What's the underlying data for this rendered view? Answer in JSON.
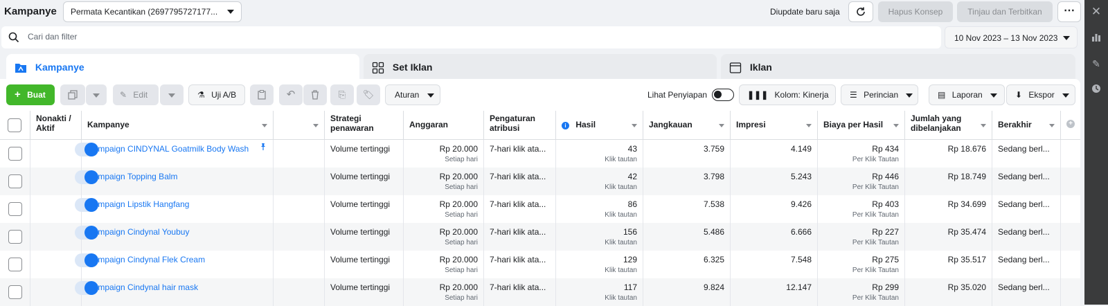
{
  "header": {
    "title": "Kampanye",
    "account": "Permata Kecantikan (2697795727177...",
    "updated": "Diupdate baru saja",
    "discard_label": "Hapus Konsep",
    "publish_label": "Tinjau dan Terbitkan"
  },
  "search": {
    "placeholder": "Cari dan filter",
    "date_range": "10 Nov 2023 – 13 Nov 2023"
  },
  "tabs": [
    {
      "label": "Kampanye",
      "active": true
    },
    {
      "label": "Set Iklan",
      "active": false
    },
    {
      "label": "Iklan",
      "active": false
    }
  ],
  "toolbar": {
    "create": "Buat",
    "edit": "Edit",
    "ab_test": "Uji A/B",
    "rules": "Aturan",
    "preview": "Lihat Penyiapan",
    "columns": "Kolom: Kinerja",
    "breakdown": "Perincian",
    "reports": "Laporan",
    "export": "Ekspor"
  },
  "table": {
    "columns": {
      "toggle": "Nonakti / Aktif",
      "campaign": "Kampanye",
      "bid": "Strategi penawaran",
      "budget": "Anggaran",
      "attribution": "Pengaturan atribusi",
      "results": "Hasil",
      "reach": "Jangkauan",
      "impressions": "Impresi",
      "cost": "Biaya per Hasil",
      "spent": "Jumlah yang dibelanjakan",
      "ends": "Berakhir"
    },
    "rows": [
      {
        "name": "Campaign CINDYNAL Goatmilk Body Wash",
        "bid": "Volume tertinggi",
        "budget": "Rp 20.000",
        "budget_sub": "Setiap hari",
        "attribution": "7-hari klik ata...",
        "results": "43",
        "results_sub": "Klik tautan",
        "reach": "3.759",
        "impressions": "4.149",
        "cost": "Rp 434",
        "cost_sub": "Per Klik Tautan",
        "spent": "Rp 18.676",
        "ends": "Sedang berl..."
      },
      {
        "name": "Campaign Topping Balm",
        "bid": "Volume tertinggi",
        "budget": "Rp 20.000",
        "budget_sub": "Setiap hari",
        "attribution": "7-hari klik ata...",
        "results": "42",
        "results_sub": "Klik tautan",
        "reach": "3.798",
        "impressions": "5.243",
        "cost": "Rp 446",
        "cost_sub": "Per Klik Tautan",
        "spent": "Rp 18.749",
        "ends": "Sedang berl..."
      },
      {
        "name": "Campaign Lipstik Hangfang",
        "bid": "Volume tertinggi",
        "budget": "Rp 20.000",
        "budget_sub": "Setiap hari",
        "attribution": "7-hari klik ata...",
        "results": "86",
        "results_sub": "Klik tautan",
        "reach": "7.538",
        "impressions": "9.426",
        "cost": "Rp 403",
        "cost_sub": "Per Klik Tautan",
        "spent": "Rp 34.699",
        "ends": "Sedang berl..."
      },
      {
        "name": "Campaign Cindynal Youbuy",
        "bid": "Volume tertinggi",
        "budget": "Rp 20.000",
        "budget_sub": "Setiap hari",
        "attribution": "7-hari klik ata...",
        "results": "156",
        "results_sub": "Klik tautan",
        "reach": "5.486",
        "impressions": "6.666",
        "cost": "Rp 227",
        "cost_sub": "Per Klik Tautan",
        "spent": "Rp 35.474",
        "ends": "Sedang berl..."
      },
      {
        "name": "Campaign Cindynal Flek Cream",
        "bid": "Volume tertinggi",
        "budget": "Rp 20.000",
        "budget_sub": "Setiap hari",
        "attribution": "7-hari klik ata...",
        "results": "129",
        "results_sub": "Klik tautan",
        "reach": "6.325",
        "impressions": "7.548",
        "cost": "Rp 275",
        "cost_sub": "Per Klik Tautan",
        "spent": "Rp 35.517",
        "ends": "Sedang berl..."
      },
      {
        "name": "Campaign Cindynal hair mask",
        "bid": "Volume tertinggi",
        "budget": "Rp 20.000",
        "budget_sub": "Setiap hari",
        "attribution": "7-hari klik ata...",
        "results": "117",
        "results_sub": "Klik tautan",
        "reach": "9.824",
        "impressions": "12.147",
        "cost": "Rp 299",
        "cost_sub": "Per Klik Tautan",
        "spent": "Rp 35.020",
        "ends": "Sedang berl..."
      }
    ]
  },
  "colors": {
    "accent": "#1877f2",
    "create_button": "#42b72a",
    "row_alt": "#f5f6f7",
    "side_bar": "#3a3b3c"
  },
  "icons": [
    "search-icon",
    "refresh-icon",
    "more-icon",
    "close-icon",
    "chart-icon",
    "pencil-icon",
    "clock-icon",
    "pin-icon",
    "info-icon",
    "plus-icon"
  ]
}
